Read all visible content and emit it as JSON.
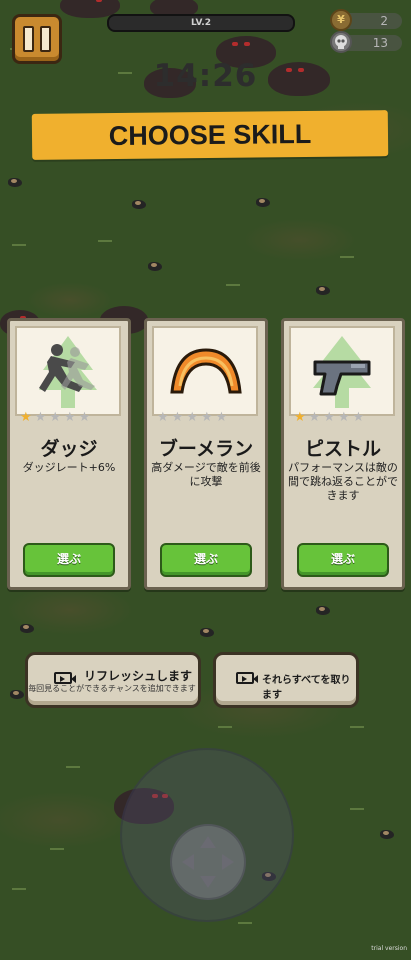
{
  "hud": {
    "level_label": "LV.2",
    "coins": "2",
    "kills": "13",
    "timer": "14:26"
  },
  "banner": {
    "title": "CHOOSE SKILL"
  },
  "skills": [
    {
      "name": "ダッジ",
      "description": "ダッジレート+6%",
      "choose_label": "選ぶ",
      "stars_filled": 1,
      "stars_total": 5,
      "icon": "dodge-icon"
    },
    {
      "name": "ブーメラン",
      "description": "高ダメージで敵を前後に攻撃",
      "choose_label": "選ぶ",
      "stars_filled": 0,
      "stars_total": 5,
      "icon": "boomerang-icon"
    },
    {
      "name": "ピストル",
      "description": "パフォーマンスは敵の間で跳ね返ることができます",
      "choose_label": "選ぶ",
      "stars_filled": 1,
      "stars_total": 5,
      "icon": "pistol-icon"
    }
  ],
  "actions": {
    "refresh_label": "リフレッシュします",
    "refresh_note": "毎回見ることができるチャンスを追加できます",
    "take_all_label": "それらすべてを取ります"
  },
  "watermark": "trial version",
  "colors": {
    "banner": "#f0b02e",
    "choose_button": "#67c33a",
    "card": "#d9d2bf",
    "star_on": "#f0b02e",
    "grass": "#3e5a2b"
  }
}
